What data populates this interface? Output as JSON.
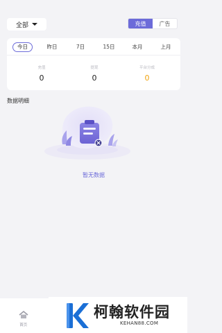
{
  "header": {
    "filter": {
      "selected": "全部"
    },
    "type_tabs": [
      {
        "label": "充值",
        "active": true
      },
      {
        "label": "广告",
        "active": false
      }
    ]
  },
  "period_tabs": [
    {
      "label": "今日",
      "active": true
    },
    {
      "label": "昨日",
      "active": false
    },
    {
      "label": "7日",
      "active": false
    },
    {
      "label": "15日",
      "active": false
    },
    {
      "label": "本月",
      "active": false
    },
    {
      "label": "上月",
      "active": false
    }
  ],
  "metrics": [
    {
      "label": "充值",
      "value": "0"
    },
    {
      "label": "提现",
      "value": "0"
    },
    {
      "label": "平台分成",
      "value": "0"
    }
  ],
  "section_title": "数据明细",
  "empty_state": {
    "text": "暂无数据"
  },
  "bottom_nav": {
    "home_label": "首页"
  },
  "watermark": {
    "brand": "柯翰软件园",
    "domain": "KEHAN88.COM"
  },
  "colors": {
    "accent": "#6c6bd9",
    "highlight": "#f0a30e",
    "background": "#f3f3f6"
  }
}
